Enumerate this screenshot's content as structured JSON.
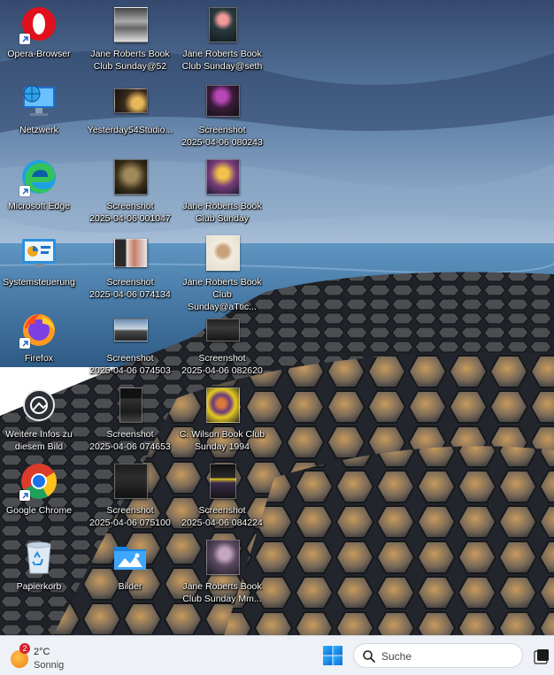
{
  "desktop": {
    "icons": [
      {
        "label": "Opera-Browser",
        "icon": "opera-icon"
      },
      {
        "label": "Netzwerk",
        "icon": "network-icon"
      },
      {
        "label": "Microsoft Edge",
        "icon": "edge-icon"
      },
      {
        "label": "Systemsteuerung",
        "icon": "control-panel-icon"
      },
      {
        "label": "Firefox",
        "icon": "firefox-icon"
      },
      {
        "label": "Weitere Infos zu\ndiesem Bild",
        "icon": "camera-info-icon"
      },
      {
        "label": "Google Chrome",
        "icon": "chrome-icon"
      },
      {
        "label": "Papierkorb",
        "icon": "recycle-bin-icon"
      },
      {
        "label": "Jane Roberts Book\nClub Sunday@52",
        "icon": "image-thumbnail-icon"
      },
      {
        "label": "Yesterday54Studio...",
        "icon": "image-thumbnail-icon"
      },
      {
        "label": "Screenshot\n2025-04-06 001047",
        "icon": "image-thumbnail-icon"
      },
      {
        "label": "Screenshot\n2025-04-06 074134",
        "icon": "image-thumbnail-icon"
      },
      {
        "label": "Screenshot\n2025-04-06 074503",
        "icon": "image-thumbnail-icon"
      },
      {
        "label": "Screenshot\n2025-04-06 074653",
        "icon": "image-thumbnail-icon"
      },
      {
        "label": "Screenshot\n2025-04-06 075100",
        "icon": "image-thumbnail-icon"
      },
      {
        "label": "Bilder",
        "icon": "pictures-folder-icon"
      },
      {
        "label": "Jane Roberts Book\nClub Sunday@seth",
        "icon": "image-thumbnail-icon"
      },
      {
        "label": "Screenshot\n2025-04-06 080243",
        "icon": "image-thumbnail-icon"
      },
      {
        "label": "Jane Roberts Book\nClub Sunday",
        "icon": "image-thumbnail-icon"
      },
      {
        "label": "Jane Roberts Book\nClub Sunday@aTtic...",
        "icon": "image-thumbnail-icon"
      },
      {
        "label": "Screenshot\n2025-04-06 082620",
        "icon": "image-thumbnail-icon"
      },
      {
        "label": "C. Wilson Book Club\nSunday 1994",
        "icon": "image-thumbnail-icon"
      },
      {
        "label": "Screenshot\n2025-04-06 084224",
        "icon": "image-thumbnail-icon"
      },
      {
        "label": "Jane Roberts Book\nClub Sunday Mm...",
        "icon": "image-thumbnail-icon"
      }
    ]
  },
  "taskbar": {
    "weather": {
      "badge": "2",
      "temperature": "2°C",
      "condition": "Sonnig"
    },
    "search": {
      "placeholder": "Suche"
    },
    "start_icon": "windows-start-icon",
    "task_view_icon": "task-view-icon"
  },
  "colors": {
    "sky_top": "#3d5478",
    "sea": "#4f86b4",
    "taskbar": "#eef1f6",
    "windows_blue": "#1a8cf0",
    "icon_label": "#ffffff"
  }
}
